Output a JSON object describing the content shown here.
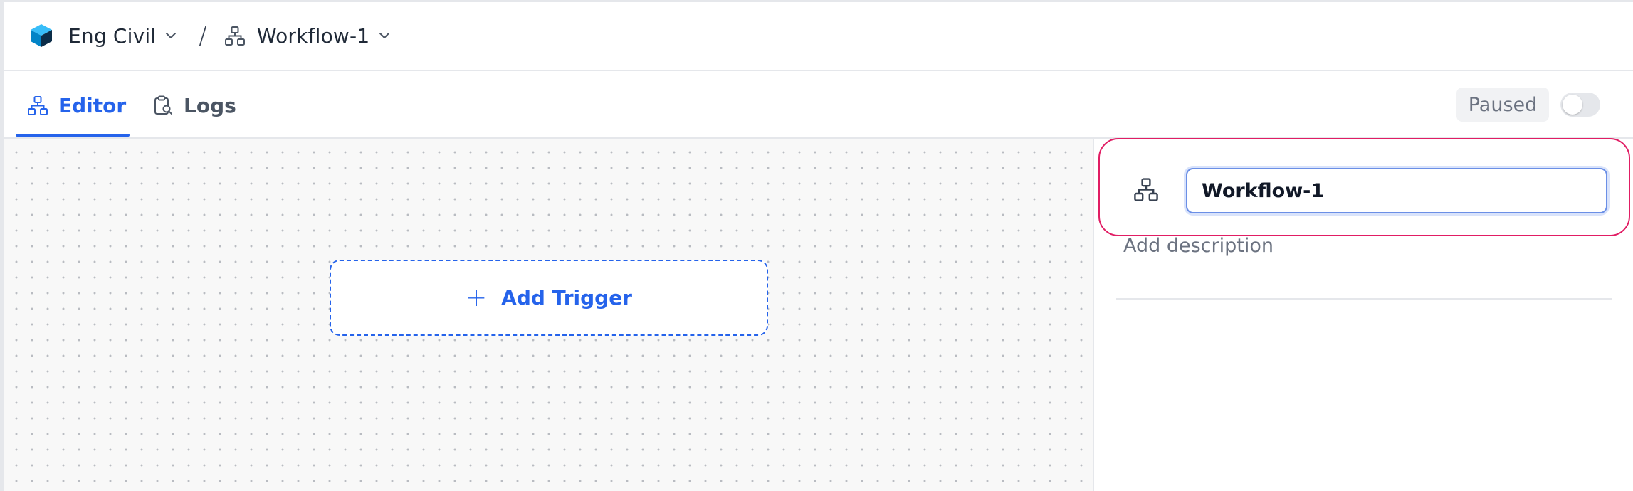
{
  "breadcrumb": {
    "project": "Eng Civil",
    "separator": "/",
    "workflow": "Workflow-1"
  },
  "tabs": [
    {
      "label": "Editor",
      "active": true
    },
    {
      "label": "Logs",
      "active": false
    }
  ],
  "status": {
    "label": "Paused",
    "toggle_on": false
  },
  "canvas": {
    "add_trigger_label": "Add Trigger"
  },
  "panel": {
    "name_value": "Workflow-1",
    "description_placeholder": "Add description"
  },
  "colors": {
    "accent": "#2563eb",
    "highlight": "#e11d64",
    "logo": "#0ea5e9"
  },
  "icons": {
    "logo": "cube-logo-icon",
    "workflow": "workflow-icon",
    "logs": "clipboard-search-icon",
    "chevron": "chevron-down-icon",
    "plus": "plus-icon"
  }
}
